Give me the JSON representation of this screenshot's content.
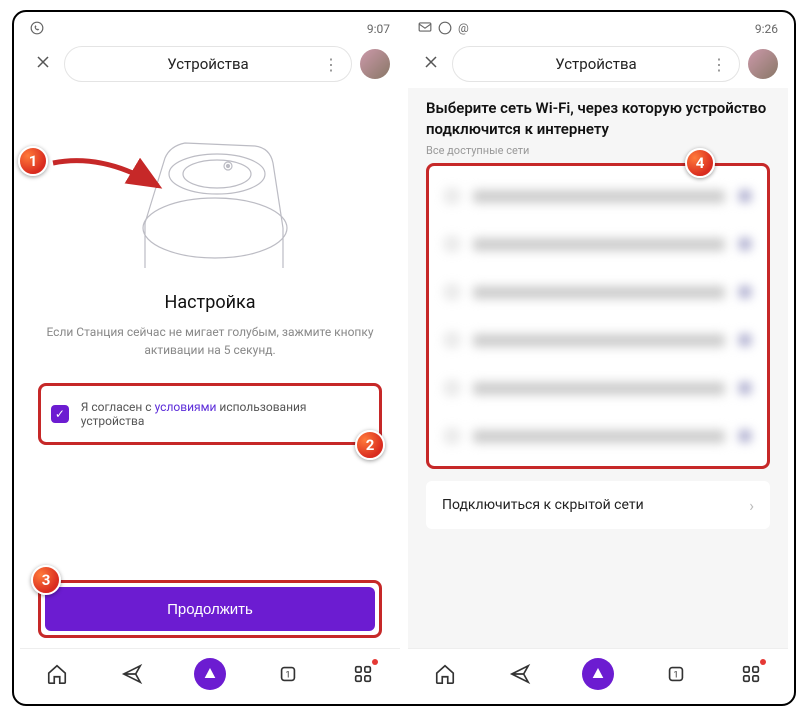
{
  "left": {
    "status": {
      "time": "9:07"
    },
    "header": {
      "title": "Устройства"
    },
    "setup": {
      "title": "Настройка",
      "subtitle": "Если Станция сейчас не мигает голубым, зажмите кнопку активации на 5 секунд."
    },
    "terms": {
      "pre": "Я согласен с ",
      "link": "условиями",
      "post": " использования устройства"
    },
    "continue_label": "Продолжить"
  },
  "right": {
    "status": {
      "time": "9:26"
    },
    "header": {
      "title": "Устройства"
    },
    "wifi": {
      "title": "Выберите сеть Wi-Fi, через которую устройство подключится к интернету",
      "subtitle": "Все доступные сети",
      "hidden_label": "Подключиться к скрытой сети"
    }
  },
  "badges": {
    "b1": "1",
    "b2": "2",
    "b3": "3",
    "b4": "4"
  }
}
